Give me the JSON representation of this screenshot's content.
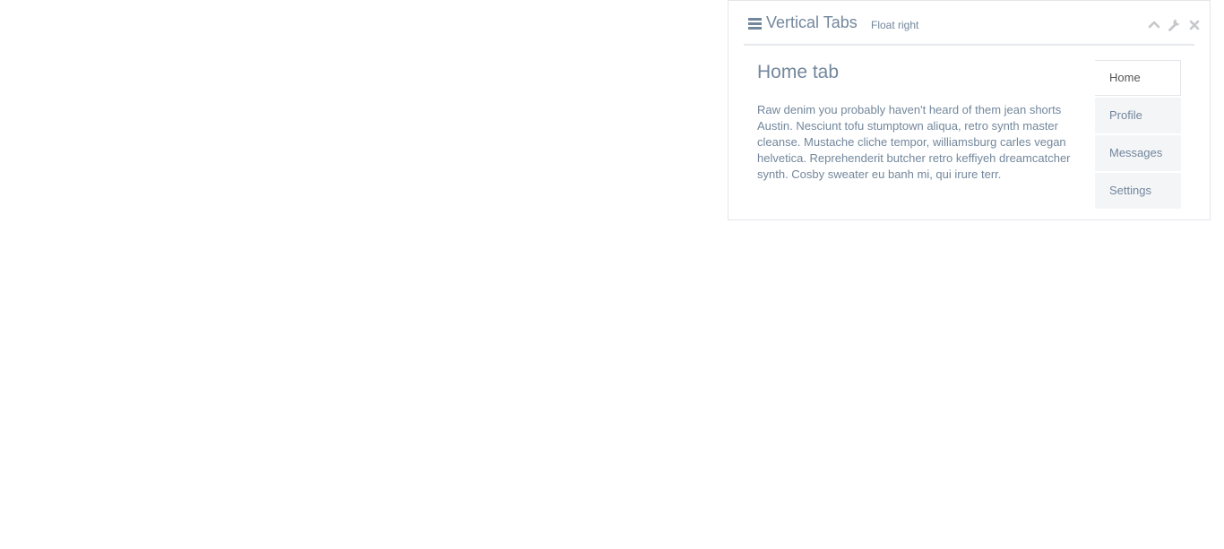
{
  "panel": {
    "title": "Vertical Tabs",
    "subtitle": "Float right",
    "tools": [
      "collapse-icon",
      "wrench-icon",
      "close-icon"
    ]
  },
  "content": {
    "heading": "Home tab",
    "body": "Raw denim you probably haven't heard of them jean shorts Austin. Nesciunt tofu stumptown aliqua, retro synth master cleanse. Mustache cliche tempor, williamsburg carles vegan helvetica. Reprehenderit butcher retro keffiyeh dreamcatcher synth. Cosby sweater eu banh mi, qui irure terr."
  },
  "tabs": [
    {
      "label": "Home",
      "active": true
    },
    {
      "label": "Profile",
      "active": false
    },
    {
      "label": "Messages",
      "active": false
    },
    {
      "label": "Settings",
      "active": false
    }
  ],
  "colors": {
    "text": "#73879c",
    "border": "#e4e6ea",
    "tab_bg": "#f4f5f7",
    "icon": "#c5c7cb"
  }
}
